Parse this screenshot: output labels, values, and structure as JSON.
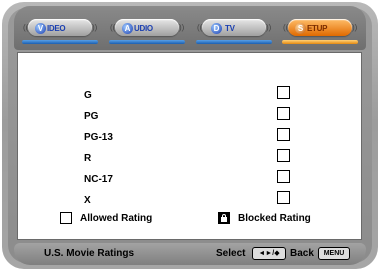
{
  "tabs": [
    {
      "icon": "V",
      "label": "IDEO",
      "active": false
    },
    {
      "icon": "A",
      "label": "UDIO",
      "active": false
    },
    {
      "icon": "D",
      "label": "TV",
      "active": false
    },
    {
      "icon": "S",
      "label": "ETUP",
      "active": true
    }
  ],
  "ratings": [
    {
      "label": "G",
      "checked": false
    },
    {
      "label": "PG",
      "checked": false
    },
    {
      "label": "PG-13",
      "checked": false
    },
    {
      "label": "R",
      "checked": false
    },
    {
      "label": "NC-17",
      "checked": false
    },
    {
      "label": "X",
      "checked": false
    }
  ],
  "legend": {
    "allowed": "Allowed Rating",
    "blocked": "Blocked Rating"
  },
  "status": {
    "title": "U.S. Movie Ratings",
    "select_label": "Select",
    "select_key": "◄►/◆",
    "back_label": "Back",
    "back_key": "MENU"
  },
  "colors": {
    "active_tab": "#e06a00",
    "inactive_tab_underline": "#1b5fb0"
  }
}
